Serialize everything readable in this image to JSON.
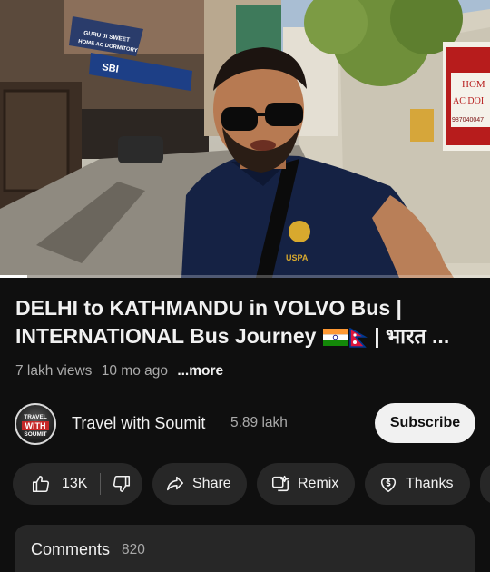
{
  "video": {
    "progress_fraction": 0.055,
    "scene_signs": {
      "sweet_home_line1": "GURU JI SWEET",
      "sweet_home_line2": "HOME AC DORMITORY",
      "bank": "SBI",
      "tshirt_logo": "USPA",
      "right_sign_line1": "HOM",
      "right_sign_line2": "AC DOI",
      "right_sign_line3": "987040047"
    }
  },
  "title": {
    "line1": "DELHI to KATHMANDU in VOLVO Bus |",
    "line2_text": "INTERNATIONAL Bus Journey",
    "line2_tail": "| भारत ...",
    "flags": [
      "india-flag-icon",
      "nepal-flag-icon"
    ]
  },
  "meta": {
    "views": "7 lakh views",
    "age": "10 mo ago",
    "more": "...more"
  },
  "channel": {
    "name": "Travel with Soumit",
    "subscribers": "5.89 lakh",
    "avatar_line1": "TRAVEL",
    "avatar_line2": "WITH",
    "avatar_line3": "SOUMIT",
    "subscribe_label": "Subscribe"
  },
  "actions": {
    "like_count": "13K",
    "share_label": "Share",
    "remix_label": "Remix",
    "thanks_label": "Thanks"
  },
  "comments": {
    "title": "Comments",
    "count": "820"
  },
  "colors": {
    "background": "#0f0f0f",
    "chip": "#272727",
    "text_primary": "#f1f1f1",
    "text_secondary": "#aaaaaa",
    "subscribe_bg": "#f1f1f1"
  }
}
